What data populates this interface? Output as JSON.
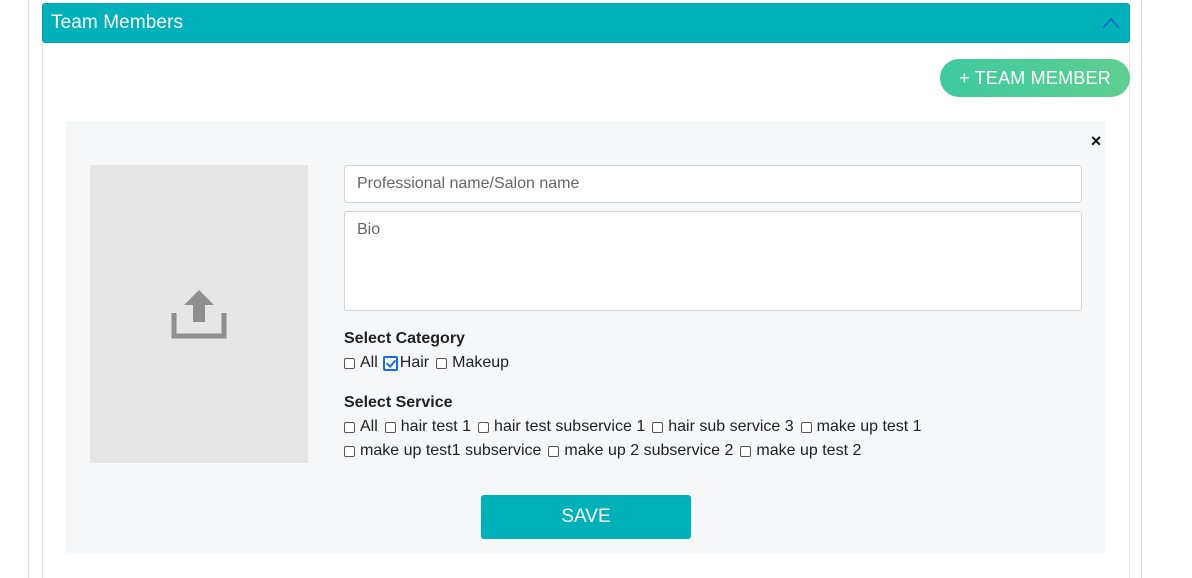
{
  "panel": {
    "title": "Team Members"
  },
  "actions": {
    "add_member_label": "+ TEAM MEMBER",
    "close_label": "×"
  },
  "form": {
    "name_placeholder": "Professional name/Salon name",
    "name_value": "",
    "bio_placeholder": "Bio",
    "bio_value": "",
    "category_label": "Select Category",
    "categories": [
      {
        "label": "All",
        "checked": false
      },
      {
        "label": "Hair",
        "checked": true
      },
      {
        "label": "Makeup",
        "checked": false
      }
    ],
    "service_label": "Select Service",
    "services_row1": [
      {
        "label": "All",
        "checked": false
      },
      {
        "label": "hair test 1",
        "checked": false
      },
      {
        "label": "hair test subservice 1",
        "checked": false
      },
      {
        "label": "hair sub service 3",
        "checked": false
      },
      {
        "label": "make up test 1",
        "checked": false
      }
    ],
    "services_row2": [
      {
        "label": "make up test1 subservice",
        "checked": false
      },
      {
        "label": "make up 2 subservice 2",
        "checked": false
      },
      {
        "label": "make up test 2",
        "checked": false
      }
    ],
    "save_label": "SAVE"
  },
  "icons": {
    "upload": "upload-icon",
    "collapse": "chevron-up-icon",
    "close": "close-icon"
  },
  "colors": {
    "header": "#00b1b9",
    "add_button": "#4ccc98",
    "form_bg": "#f6f7f9",
    "checkbox_checked": "#1a6fe8"
  }
}
